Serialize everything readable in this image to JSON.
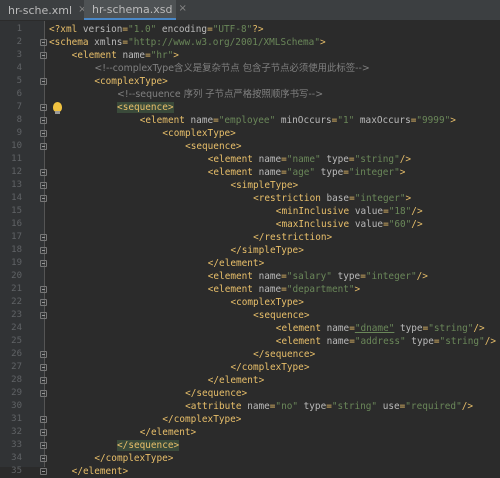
{
  "tabs": [
    {
      "label": "hr-sche.xml",
      "active": false,
      "icon": "xml-file-icon"
    },
    {
      "label": "hr-schema.xsd",
      "active": true,
      "icon": "xsd-file-icon"
    }
  ],
  "lines": [
    {
      "n": "1",
      "indent": 0,
      "segs": [
        [
          "p",
          "<?"
        ],
        [
          "t",
          "xml "
        ],
        [
          "a",
          "version"
        ],
        [
          "p",
          "="
        ],
        [
          "v",
          "\"1.0\""
        ],
        [
          "a",
          " encoding"
        ],
        [
          "p",
          "="
        ],
        [
          "v",
          "\"UTF-8\""
        ],
        [
          "p",
          "?>"
        ]
      ]
    },
    {
      "n": "2",
      "indent": 0,
      "segs": [
        [
          "p",
          "<"
        ],
        [
          "t",
          "schema "
        ],
        [
          "a",
          "xmlns"
        ],
        [
          "p",
          "="
        ],
        [
          "v",
          "\"http://www.w3.org/2001/XMLSchema\""
        ],
        [
          "p",
          ">"
        ]
      ]
    },
    {
      "n": "3",
      "indent": 1,
      "segs": [
        [
          "p",
          "<"
        ],
        [
          "t",
          "element "
        ],
        [
          "a",
          "name"
        ],
        [
          "p",
          "="
        ],
        [
          "v",
          "\"hr\""
        ],
        [
          "p",
          ">"
        ]
      ]
    },
    {
      "n": "4",
      "indent": 2,
      "segs": [
        [
          "c",
          "<!--complexType含义是复杂节点 包含子节点必须使用此标签-->"
        ]
      ]
    },
    {
      "n": "5",
      "indent": 2,
      "segs": [
        [
          "p",
          "<"
        ],
        [
          "t",
          "complexType"
        ],
        [
          "p",
          ">"
        ]
      ]
    },
    {
      "n": "6",
      "indent": 3,
      "segs": [
        [
          "c",
          "<!--sequence 序列 子节点严格按照顺序书写-->"
        ]
      ]
    },
    {
      "n": "7",
      "indent": 3,
      "hl": true,
      "segs": [
        [
          "p",
          "<"
        ],
        [
          "t",
          "sequence"
        ],
        [
          "p",
          ">"
        ]
      ]
    },
    {
      "n": "8",
      "indent": 4,
      "segs": [
        [
          "p",
          "<"
        ],
        [
          "t",
          "element "
        ],
        [
          "a",
          "name"
        ],
        [
          "p",
          "="
        ],
        [
          "v",
          "\"employee\""
        ],
        [
          "a",
          " minOccurs"
        ],
        [
          "p",
          "="
        ],
        [
          "v",
          "\"1\""
        ],
        [
          "a",
          " maxOccurs"
        ],
        [
          "p",
          "="
        ],
        [
          "v",
          "\"9999\""
        ],
        [
          "p",
          ">"
        ]
      ]
    },
    {
      "n": "9",
      "indent": 5,
      "segs": [
        [
          "p",
          "<"
        ],
        [
          "t",
          "complexType"
        ],
        [
          "p",
          ">"
        ]
      ]
    },
    {
      "n": "10",
      "indent": 6,
      "segs": [
        [
          "p",
          "<"
        ],
        [
          "t",
          "sequence"
        ],
        [
          "p",
          ">"
        ]
      ]
    },
    {
      "n": "11",
      "indent": 7,
      "segs": [
        [
          "p",
          "<"
        ],
        [
          "t",
          "element "
        ],
        [
          "a",
          "name"
        ],
        [
          "p",
          "="
        ],
        [
          "v",
          "\"name\""
        ],
        [
          "a",
          " type"
        ],
        [
          "p",
          "="
        ],
        [
          "v",
          "\"string\""
        ],
        [
          "p",
          "/>"
        ]
      ]
    },
    {
      "n": "12",
      "indent": 7,
      "segs": [
        [
          "p",
          "<"
        ],
        [
          "t",
          "element "
        ],
        [
          "a",
          "name"
        ],
        [
          "p",
          "="
        ],
        [
          "v",
          "\"age\""
        ],
        [
          "a",
          " type"
        ],
        [
          "p",
          "="
        ],
        [
          "v",
          "\"integer\""
        ],
        [
          "p",
          ">"
        ]
      ]
    },
    {
      "n": "13",
      "indent": 8,
      "segs": [
        [
          "p",
          "<"
        ],
        [
          "t",
          "simpleType"
        ],
        [
          "p",
          ">"
        ]
      ]
    },
    {
      "n": "14",
      "indent": 9,
      "segs": [
        [
          "p",
          "<"
        ],
        [
          "t",
          "restriction "
        ],
        [
          "a",
          "base"
        ],
        [
          "p",
          "="
        ],
        [
          "v",
          "\"integer\""
        ],
        [
          "p",
          ">"
        ]
      ]
    },
    {
      "n": "15",
      "indent": 10,
      "segs": [
        [
          "p",
          "<"
        ],
        [
          "t",
          "minInclusive "
        ],
        [
          "a",
          "value"
        ],
        [
          "p",
          "="
        ],
        [
          "v",
          "\"18\""
        ],
        [
          "p",
          "/>"
        ]
      ]
    },
    {
      "n": "16",
      "indent": 10,
      "segs": [
        [
          "p",
          "<"
        ],
        [
          "t",
          "maxInclusive "
        ],
        [
          "a",
          "value"
        ],
        [
          "p",
          "="
        ],
        [
          "v",
          "\"60\""
        ],
        [
          "p",
          "/>"
        ]
      ]
    },
    {
      "n": "17",
      "indent": 9,
      "segs": [
        [
          "p",
          "</"
        ],
        [
          "t",
          "restriction"
        ],
        [
          "p",
          ">"
        ]
      ]
    },
    {
      "n": "18",
      "indent": 8,
      "segs": [
        [
          "p",
          "</"
        ],
        [
          "t",
          "simpleType"
        ],
        [
          "p",
          ">"
        ]
      ]
    },
    {
      "n": "19",
      "indent": 7,
      "segs": [
        [
          "p",
          "</"
        ],
        [
          "t",
          "element"
        ],
        [
          "p",
          ">"
        ]
      ]
    },
    {
      "n": "20",
      "indent": 7,
      "segs": [
        [
          "p",
          "<"
        ],
        [
          "t",
          "element "
        ],
        [
          "a",
          "name"
        ],
        [
          "p",
          "="
        ],
        [
          "v",
          "\"salary\""
        ],
        [
          "a",
          " type"
        ],
        [
          "p",
          "="
        ],
        [
          "v",
          "\"integer\""
        ],
        [
          "p",
          "/>"
        ]
      ]
    },
    {
      "n": "21",
      "indent": 7,
      "segs": [
        [
          "p",
          "<"
        ],
        [
          "t",
          "element "
        ],
        [
          "a",
          "name"
        ],
        [
          "p",
          "="
        ],
        [
          "v",
          "\"department\""
        ],
        [
          "p",
          ">"
        ]
      ]
    },
    {
      "n": "22",
      "indent": 8,
      "segs": [
        [
          "p",
          "<"
        ],
        [
          "t",
          "complexType"
        ],
        [
          "p",
          ">"
        ]
      ]
    },
    {
      "n": "23",
      "indent": 9,
      "segs": [
        [
          "p",
          "<"
        ],
        [
          "t",
          "sequence"
        ],
        [
          "p",
          ">"
        ]
      ]
    },
    {
      "n": "24",
      "indent": 10,
      "segs": [
        [
          "p",
          "<"
        ],
        [
          "t",
          "element "
        ],
        [
          "a",
          "name"
        ],
        [
          "p",
          "="
        ],
        [
          "vu",
          "\"dname\""
        ],
        [
          "a",
          " type"
        ],
        [
          "p",
          "="
        ],
        [
          "v",
          "\"string\""
        ],
        [
          "p",
          "/>"
        ]
      ]
    },
    {
      "n": "25",
      "indent": 10,
      "segs": [
        [
          "p",
          "<"
        ],
        [
          "t",
          "element "
        ],
        [
          "a",
          "name"
        ],
        [
          "p",
          "="
        ],
        [
          "v",
          "\"address\""
        ],
        [
          "a",
          " type"
        ],
        [
          "p",
          "="
        ],
        [
          "v",
          "\"string\""
        ],
        [
          "p",
          "/>"
        ]
      ]
    },
    {
      "n": "26",
      "indent": 9,
      "segs": [
        [
          "p",
          "</"
        ],
        [
          "t",
          "sequence"
        ],
        [
          "p",
          ">"
        ]
      ]
    },
    {
      "n": "27",
      "indent": 8,
      "segs": [
        [
          "p",
          "</"
        ],
        [
          "t",
          "complexType"
        ],
        [
          "p",
          ">"
        ]
      ]
    },
    {
      "n": "28",
      "indent": 7,
      "segs": [
        [
          "p",
          "</"
        ],
        [
          "t",
          "element"
        ],
        [
          "p",
          ">"
        ]
      ]
    },
    {
      "n": "29",
      "indent": 6,
      "segs": [
        [
          "p",
          "</"
        ],
        [
          "t",
          "sequence"
        ],
        [
          "p",
          ">"
        ]
      ]
    },
    {
      "n": "30",
      "indent": 6,
      "segs": [
        [
          "p",
          "<"
        ],
        [
          "t",
          "attribute "
        ],
        [
          "a",
          "name"
        ],
        [
          "p",
          "="
        ],
        [
          "v",
          "\"no\""
        ],
        [
          "a",
          " type"
        ],
        [
          "p",
          "="
        ],
        [
          "v",
          "\"string\""
        ],
        [
          "a",
          " use"
        ],
        [
          "p",
          "="
        ],
        [
          "v",
          "\"required\""
        ],
        [
          "p",
          "/>"
        ]
      ]
    },
    {
      "n": "31",
      "indent": 5,
      "segs": [
        [
          "p",
          "</"
        ],
        [
          "t",
          "complexType"
        ],
        [
          "p",
          ">"
        ]
      ]
    },
    {
      "n": "32",
      "indent": 4,
      "segs": [
        [
          "p",
          "</"
        ],
        [
          "t",
          "element"
        ],
        [
          "p",
          ">"
        ]
      ]
    },
    {
      "n": "33",
      "indent": 3,
      "hl": true,
      "segs": [
        [
          "p",
          "</"
        ],
        [
          "t",
          "sequence"
        ],
        [
          "p",
          ">"
        ]
      ]
    },
    {
      "n": "34",
      "indent": 2,
      "segs": [
        [
          "p",
          "</"
        ],
        [
          "t",
          "complexType"
        ],
        [
          "p",
          ">"
        ]
      ]
    },
    {
      "n": "35",
      "indent": 1,
      "segs": [
        [
          "p",
          "</"
        ],
        [
          "t",
          "element"
        ],
        [
          "p",
          ">"
        ]
      ]
    }
  ],
  "folds": [
    "2",
    "3",
    "5",
    "7",
    "8",
    "9",
    "10",
    "12",
    "13",
    "14",
    "17",
    "18",
    "19",
    "21",
    "22",
    "23",
    "26",
    "27",
    "28",
    "29",
    "31",
    "32",
    "33",
    "34",
    "35"
  ],
  "bulb_line": "7",
  "colors": {
    "tag": "#e8bf6a",
    "attr": "#bababa",
    "value": "#6a8759",
    "comment": "#808080",
    "background": "#2b2b2b"
  }
}
